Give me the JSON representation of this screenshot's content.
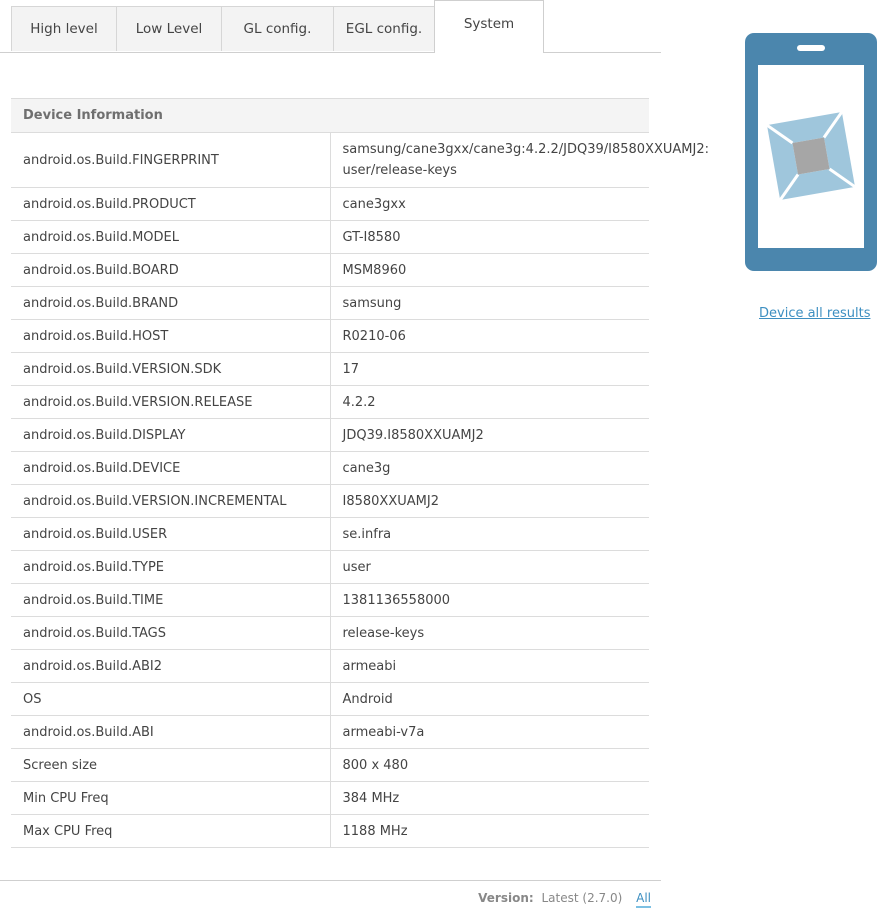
{
  "tabs": [
    {
      "label": "High level"
    },
    {
      "label": "Low Level"
    },
    {
      "label": "GL config."
    },
    {
      "label": "EGL config."
    },
    {
      "label": "System"
    }
  ],
  "device_info": {
    "header": "Device Information",
    "rows": [
      {
        "key": "android.os.Build.FINGERPRINT",
        "value": "samsung/cane3gxx/cane3g:4.2.2/JDQ39/I8580XXUAMJ2: user/release-keys"
      },
      {
        "key": "android.os.Build.PRODUCT",
        "value": "cane3gxx"
      },
      {
        "key": "android.os.Build.MODEL",
        "value": "GT-I8580"
      },
      {
        "key": "android.os.Build.BOARD",
        "value": "MSM8960"
      },
      {
        "key": "android.os.Build.BRAND",
        "value": "samsung"
      },
      {
        "key": "android.os.Build.HOST",
        "value": "R0210-06"
      },
      {
        "key": "android.os.Build.VERSION.SDK",
        "value": "17"
      },
      {
        "key": "android.os.Build.VERSION.RELEASE",
        "value": "4.2.2"
      },
      {
        "key": "android.os.Build.DISPLAY",
        "value": "JDQ39.I8580XXUAMJ2"
      },
      {
        "key": "android.os.Build.DEVICE",
        "value": "cane3g"
      },
      {
        "key": "android.os.Build.VERSION.INCREMENTAL",
        "value": "I8580XXUAMJ2"
      },
      {
        "key": "android.os.Build.USER",
        "value": "se.infra"
      },
      {
        "key": "android.os.Build.TYPE",
        "value": "user"
      },
      {
        "key": "android.os.Build.TIME",
        "value": "1381136558000"
      },
      {
        "key": "android.os.Build.TAGS",
        "value": "release-keys"
      },
      {
        "key": "android.os.Build.ABI2",
        "value": "armeabi"
      },
      {
        "key": "OS",
        "value": "Android"
      },
      {
        "key": "android.os.Build.ABI",
        "value": "armeabi-v7a"
      },
      {
        "key": "Screen size",
        "value": "800 x 480"
      },
      {
        "key": "Min CPU Freq",
        "value": "384 MHz"
      },
      {
        "key": "Max CPU Freq",
        "value": "1188 MHz"
      }
    ]
  },
  "sidebar": {
    "phone_icon": "phone-logo-icon",
    "device_link": "Device all results"
  },
  "footer": {
    "version_label": "Version:",
    "version_value": "Latest (2.7.0)",
    "all_link": "All"
  },
  "colors": {
    "phone_body": "#4b86ad",
    "logo_light": "#9fc6dc",
    "logo_gray": "#a6a6a6",
    "link": "#3d8fc1"
  }
}
